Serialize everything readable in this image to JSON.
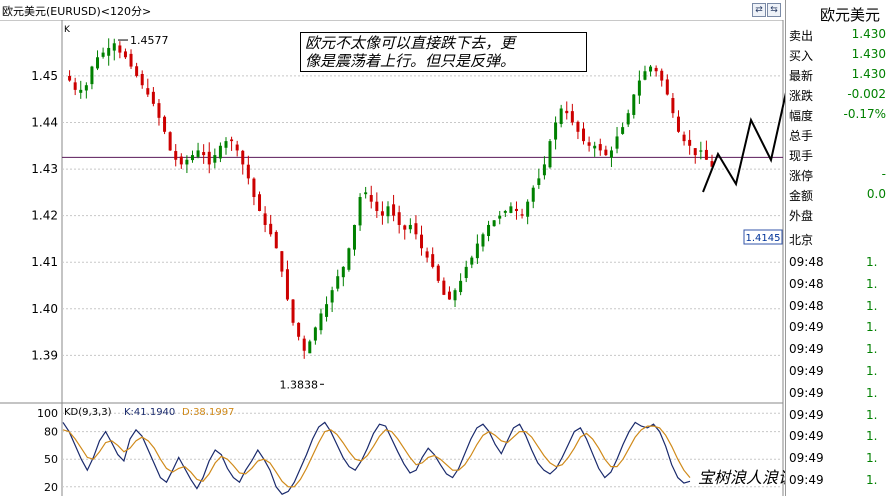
{
  "header": {
    "title": "欧元美元(EURUSD)<120分>"
  },
  "panel": {
    "k_label": "K",
    "kd_label": "KD(9,3,3)",
    "k_value_label": "K:41.1940",
    "d_value_label": "D:38.1997"
  },
  "annotations": {
    "high": "1.4577",
    "low": "1.3838",
    "price_tag": "1.4145",
    "note_line1": "欧元不太像可以直接跌下去，更",
    "note_line2": "像是震荡着上行。但只是反弹。",
    "watermark": "宝树浪人浪语"
  },
  "quote": {
    "title": "欧元美元",
    "rows": [
      {
        "label": "卖出",
        "value": "1.430"
      },
      {
        "label": "买入",
        "value": "1.430"
      },
      {
        "label": "最新",
        "value": "1.430"
      },
      {
        "label": "涨跌",
        "value": "-0.002"
      },
      {
        "label": "幅度",
        "value": "-0.17%"
      },
      {
        "label": "总手",
        "value": ""
      },
      {
        "label": "现手",
        "value": ""
      },
      {
        "label": "涨停",
        "value": "-"
      },
      {
        "label": "金额",
        "value": "0.0"
      },
      {
        "label": "外盘",
        "value": ""
      }
    ],
    "region": "北京",
    "ticks": [
      {
        "time": "09:48",
        "value": "1."
      },
      {
        "time": "09:48",
        "value": "1."
      },
      {
        "time": "09:48",
        "value": "1."
      },
      {
        "time": "09:49",
        "value": "1."
      },
      {
        "time": "09:49",
        "value": "1."
      },
      {
        "time": "09:49",
        "value": "1."
      },
      {
        "time": "09:49",
        "value": "1."
      },
      {
        "time": "09:49",
        "value": "1."
      },
      {
        "time": "09:49",
        "value": "1."
      },
      {
        "time": "09:49",
        "value": "1."
      },
      {
        "time": "09:49",
        "value": "1."
      }
    ]
  },
  "colors": {
    "up": "#008000",
    "down": "#cc0000",
    "k_line": "#1a2a6c",
    "d_line": "#d08a1a",
    "current_price_line": "#5a1a5a",
    "grid": "#c8c8c8"
  },
  "chart_data": [
    {
      "type": "candlestick",
      "title": "欧元美元(EURUSD)<120分>",
      "ylim": [
        1.383,
        1.462
      ],
      "yticks": [
        1.39,
        1.4,
        1.41,
        1.42,
        1.43,
        1.44,
        1.45
      ],
      "current_price": 1.4325,
      "max_marked": 1.4577,
      "min_marked": 1.3838,
      "close_path": [
        1.45,
        1.449,
        1.447,
        1.447,
        1.448,
        1.452,
        1.454,
        1.455,
        1.456,
        1.457,
        1.455,
        1.454,
        1.452,
        1.45,
        1.448,
        1.446,
        1.444,
        1.441,
        1.438,
        1.434,
        1.432,
        1.431,
        1.432,
        1.433,
        1.434,
        1.433,
        1.431,
        1.433,
        1.435,
        1.436,
        1.436,
        1.434,
        1.431,
        1.428,
        1.424,
        1.421,
        1.418,
        1.416,
        1.413,
        1.408,
        1.402,
        1.397,
        1.394,
        1.391,
        1.393,
        1.396,
        1.399,
        1.401,
        1.404,
        1.407,
        1.409,
        1.413,
        1.418,
        1.424,
        1.425,
        1.423,
        1.421,
        1.42,
        1.422,
        1.42,
        1.418,
        1.417,
        1.418,
        1.416,
        1.413,
        1.411,
        1.409,
        1.406,
        1.403,
        1.402,
        1.404,
        1.406,
        1.409,
        1.411,
        1.414,
        1.416,
        1.418,
        1.419,
        1.42,
        1.421,
        1.422,
        1.421,
        1.42,
        1.423,
        1.426,
        1.428,
        1.431,
        1.436,
        1.44,
        1.443,
        1.442,
        1.44,
        1.438,
        1.436,
        1.435,
        1.435,
        1.434,
        1.433,
        1.434,
        1.437,
        1.439,
        1.442,
        1.446,
        1.449,
        1.451,
        1.452,
        1.451,
        1.449,
        1.446,
        1.442,
        1.438,
        1.436,
        1.435,
        1.433,
        1.434,
        1.432,
        1.4305
      ]
    },
    {
      "type": "line",
      "title": "KD(9,3,3)",
      "ylim": [
        10,
        110
      ],
      "yticks": [
        20,
        50,
        80,
        100
      ],
      "series": [
        {
          "name": "K",
          "last": 41.194,
          "values": [
            90,
            80,
            65,
            50,
            38,
            52,
            70,
            80,
            68,
            55,
            48,
            72,
            82,
            75,
            60,
            45,
            30,
            25,
            38,
            52,
            40,
            28,
            18,
            30,
            48,
            60,
            55,
            40,
            30,
            25,
            38,
            48,
            60,
            50,
            38,
            20,
            12,
            15,
            25,
            40,
            55,
            72,
            85,
            90,
            80,
            66,
            52,
            42,
            38,
            48,
            62,
            78,
            88,
            86,
            72,
            58,
            45,
            35,
            38,
            52,
            62,
            55,
            44,
            34,
            30,
            40,
            56,
            72,
            84,
            88,
            80,
            66,
            56,
            70,
            84,
            88,
            76,
            60,
            46,
            38,
            34,
            40,
            52,
            66,
            80,
            84,
            72,
            56,
            40,
            30,
            36,
            50,
            66,
            80,
            90,
            86,
            84,
            88,
            80,
            64,
            44,
            30,
            24,
            26
          ]
        },
        {
          "name": "D",
          "last": 38.1997,
          "values": [
            82,
            80,
            72,
            62,
            52,
            50,
            58,
            68,
            70,
            65,
            58,
            62,
            70,
            74,
            70,
            62,
            50,
            40,
            36,
            40,
            42,
            36,
            28,
            26,
            34,
            46,
            53,
            50,
            43,
            35,
            34,
            40,
            48,
            50,
            46,
            36,
            26,
            20,
            20,
            28,
            40,
            54,
            68,
            80,
            82,
            77,
            68,
            58,
            50,
            48,
            54,
            64,
            75,
            82,
            80,
            72,
            62,
            52,
            44,
            46,
            52,
            54,
            50,
            44,
            38,
            38,
            44,
            54,
            66,
            76,
            80,
            76,
            70,
            68,
            74,
            80,
            80,
            74,
            64,
            54,
            46,
            42,
            44,
            52,
            62,
            74,
            78,
            72,
            62,
            50,
            42,
            42,
            50,
            62,
            74,
            82,
            86,
            86,
            84,
            76,
            64,
            50,
            38,
            30
          ]
        }
      ]
    }
  ]
}
